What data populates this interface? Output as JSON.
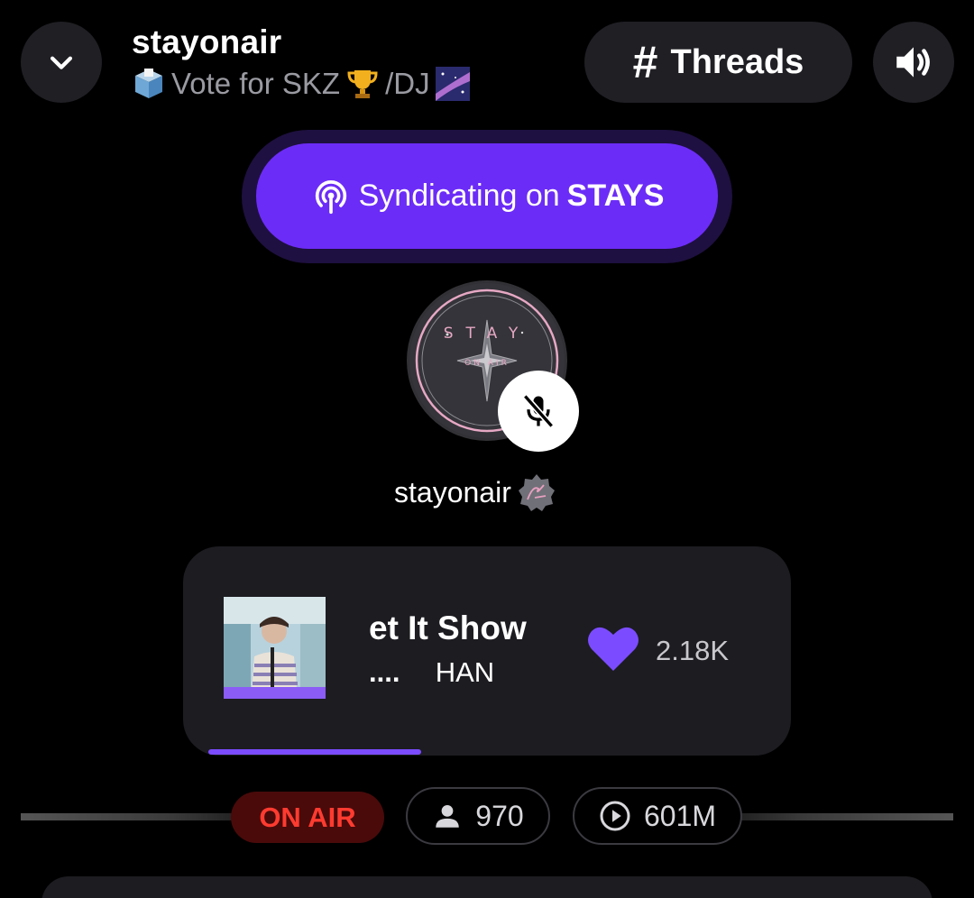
{
  "header": {
    "title": "stayonair",
    "subtitle": "Vote for SKZ",
    "subtitle_suffix": "/DJ",
    "threads_label": "Threads",
    "collapse_icon": "chevron-down-icon",
    "volume_icon": "speaker-icon"
  },
  "syndication": {
    "prefix": "Syndicating on",
    "network": "STAYS",
    "icon": "broadcast-icon"
  },
  "host": {
    "name": "stayonair",
    "avatar_text": "STAY",
    "avatar_subtext": "ON AIR",
    "mic_state_icon": "mic-off-icon"
  },
  "now_playing": {
    "title": "et It Show",
    "artist": "HAN",
    "artist_prefix": "....",
    "likes": "2.18K",
    "progress_fraction": 0.38
  },
  "stats": {
    "status": "ON AIR",
    "listeners": "970",
    "plays": "601M"
  },
  "colors": {
    "accent": "#6c2cf7",
    "heart": "#7b4cff",
    "live_red": "#ff3b30"
  }
}
